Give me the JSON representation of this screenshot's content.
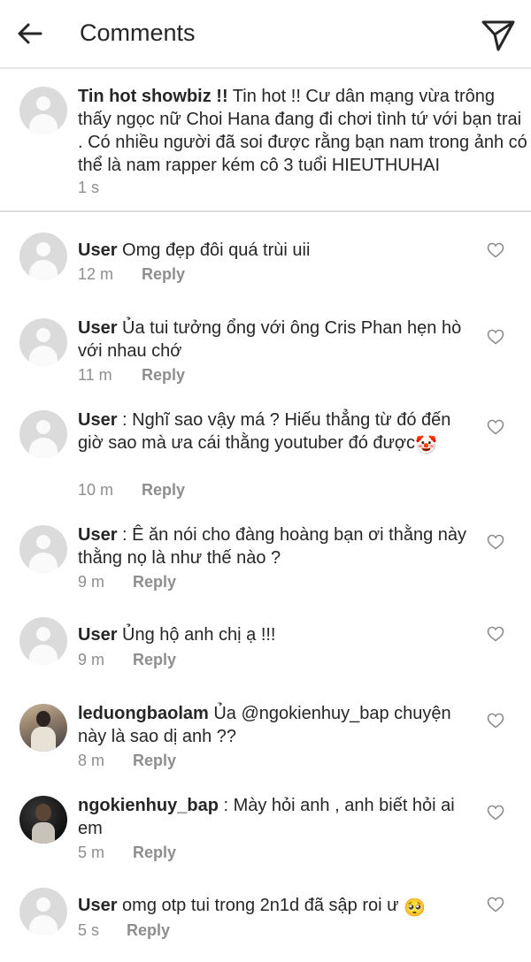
{
  "header": {
    "title": "Comments"
  },
  "caption": {
    "username": "Tin hot showbiz !!",
    "text": " Tin hot !! Cư dân mạng vừa trông thấy ngọc nữ Choi Hana đang đi chơi tình tứ với bạn trai . Có nhiều người đã soi được rằng bạn nam trong ảnh có thể là nam rapper kém cô 3 tuổi HIEUTHUHAI",
    "time": "1 s"
  },
  "reply_label": "Reply",
  "comments": [
    {
      "username": "User",
      "text": " Omg đẹp đôi quá trùi uii",
      "time": "12 m"
    },
    {
      "username": "User",
      "text": " Ủa tui tưởng ổng với ông Cris Phan hẹn hò với nhau chớ",
      "time": "11 m"
    },
    {
      "username": "User",
      "text": " : Nghĩ sao vậy má ? Hiếu thẳng từ đó đến giờ sao mà ưa cái thằng youtuber đó được",
      "emoji": "🤡",
      "time": "10 m"
    },
    {
      "username": "User",
      "text": " : Ê ăn nói cho đàng hoàng bạn ơi thằng này thằng nọ là như thế nào ?",
      "time": "9 m"
    },
    {
      "username": "User",
      "text": " Ủng hộ anh chị ạ !!!",
      "time": "9 m"
    },
    {
      "username": "leduongbaolam",
      "text": " Ủa @ngokienhuy_bap chuyện này là sao dị anh ??",
      "time": "8 m"
    },
    {
      "username": "ngokienhuy_bap",
      "text": " : Mày hỏi anh , anh biết hỏi ai em",
      "time": "5 m"
    },
    {
      "username": "User",
      "text": " omg otp tui trong 2n1d đã sập roi ư ",
      "emoji": "🥺",
      "time": "5 s"
    }
  ]
}
